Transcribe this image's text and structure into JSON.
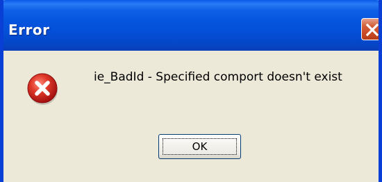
{
  "window": {
    "title": "Error",
    "close_icon": "close-icon",
    "title_color": "#ffffff",
    "titlebar_color": "#0554dc",
    "close_color": "#d45f3a"
  },
  "dialog": {
    "icon": "error-icon",
    "icon_color": "#d42020",
    "message": "ie_BadId - Specified comport doesn't exist",
    "ok_label": "OK",
    "background": "#ece9d8"
  }
}
